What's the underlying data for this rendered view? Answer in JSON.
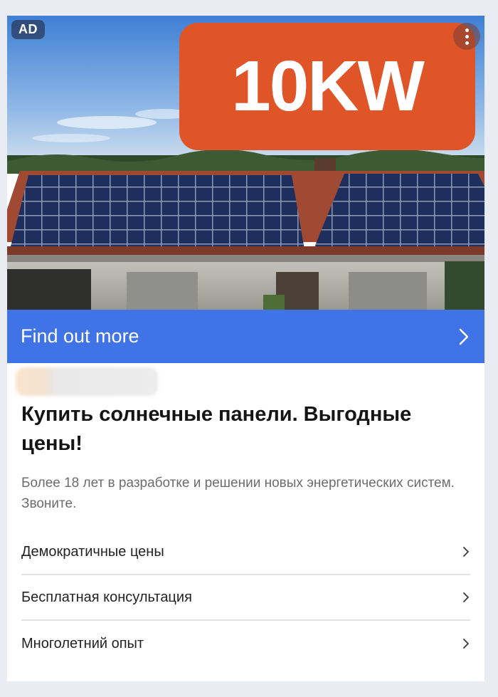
{
  "ad": {
    "badge": "AD",
    "promo_text": "10KW",
    "more_icon": "more-vertical-icon",
    "cta_label": "Find out more",
    "cta_icon": "chevron-right-icon",
    "title": "Купить солнечные панели. Выгодные цены!",
    "description": "Более 18 лет в разработке и решении новых энергетических систем. Звоните.",
    "links": [
      {
        "label": "Демократичные цены"
      },
      {
        "label": "Бесплатная консультация"
      },
      {
        "label": "Многолетний опыт"
      }
    ]
  },
  "colors": {
    "cta": "#3f73e6",
    "promo": "#e05528",
    "background": "#e9ecf3"
  }
}
